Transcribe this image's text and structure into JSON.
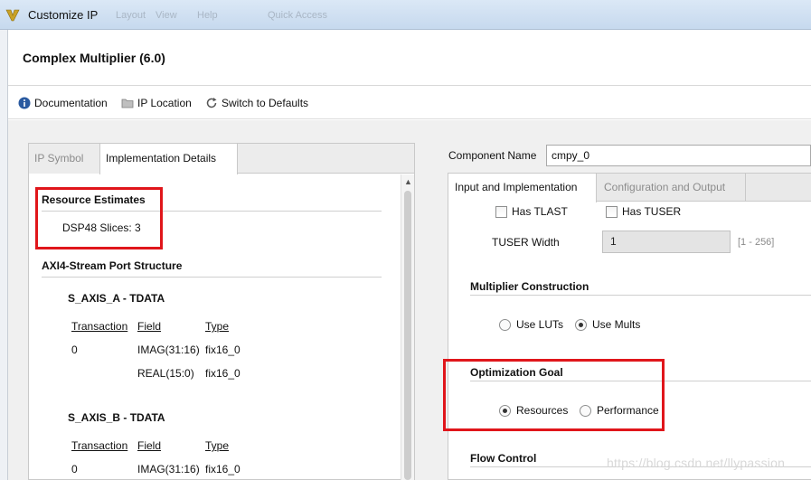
{
  "window": {
    "title": "Customize IP",
    "menu_ghost": [
      "Layout",
      "View",
      "Help",
      "Quick Access"
    ]
  },
  "header": {
    "ip_title": "Complex Multiplier (6.0)"
  },
  "toolbar": {
    "documentation": "Documentation",
    "ip_location": "IP Location",
    "switch_defaults": "Switch to Defaults"
  },
  "left_panel": {
    "tabs": {
      "ip_symbol": "IP Symbol",
      "impl_details": "Implementation Details"
    },
    "resource": {
      "title": "Resource Estimates",
      "dsp_label": "DSP48 Slices: 3"
    },
    "axi": {
      "title": "AXI4-Stream Port Structure",
      "port_a": {
        "name": "S_AXIS_A - TDATA",
        "headers": {
          "transaction": "Transaction",
          "field": "Field",
          "type": "Type"
        },
        "rows": [
          {
            "transaction": "0",
            "field": "IMAG(31:16)",
            "type": "fix16_0"
          },
          {
            "transaction": "",
            "field": "REAL(15:0)",
            "type": "fix16_0"
          }
        ]
      },
      "port_b": {
        "name": "S_AXIS_B - TDATA",
        "headers": {
          "transaction": "Transaction",
          "field": "Field",
          "type": "Type"
        },
        "rows": [
          {
            "transaction": "0",
            "field": "IMAG(31:16)",
            "type": "fix16_0"
          }
        ]
      }
    }
  },
  "right_panel": {
    "component_name_label": "Component Name",
    "component_name_value": "cmpy_0",
    "tabs": {
      "input_impl": "Input and Implementation",
      "config_output": "Configuration and Output"
    },
    "has_tlast": {
      "label": "Has TLAST",
      "checked": false
    },
    "has_tuser": {
      "label": "Has TUSER",
      "checked": false
    },
    "tuser_width": {
      "label": "TUSER Width",
      "value": "1",
      "range": "[1 - 256]"
    },
    "mult_construction": {
      "title": "Multiplier Construction",
      "use_luts": "Use LUTs",
      "use_mults": "Use Mults",
      "selected": "Use Mults"
    },
    "opt_goal": {
      "title": "Optimization Goal",
      "resources": "Resources",
      "performance": "Performance",
      "selected": "Resources"
    },
    "flow_control": {
      "title": "Flow Control"
    }
  },
  "watermark": "https://blog.csdn.net/llypassion",
  "colors": {
    "highlight_box": "#e0161b",
    "title_bar": "#c6d9ee"
  }
}
